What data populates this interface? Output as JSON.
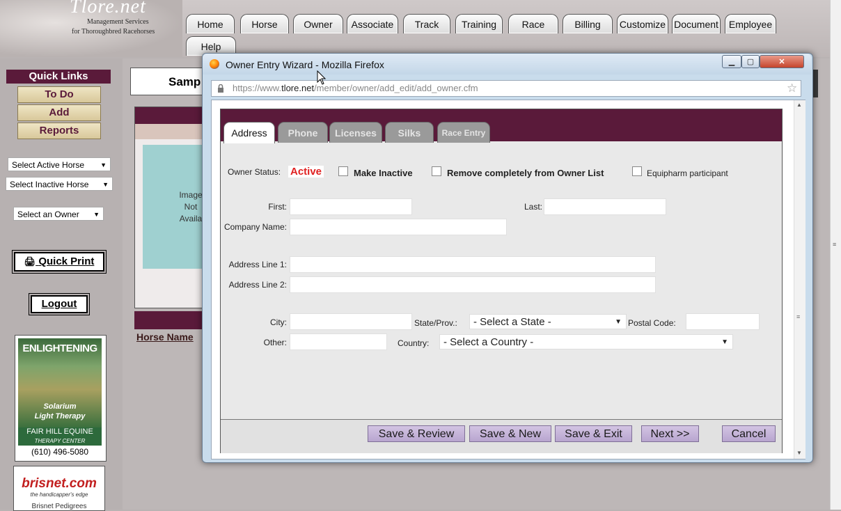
{
  "site": {
    "logo": "Tlore.net",
    "subtitle_line1": "Management Services",
    "subtitle_line2": "for Thoroughbred Racehorses",
    "nav": [
      "Home",
      "Horse",
      "Owner",
      "Associate",
      "Track",
      "Training",
      "Race",
      "Billing",
      "Customize",
      "Document",
      "Employee",
      "Help"
    ]
  },
  "sidebar": {
    "quick_links_title": "Quick Links",
    "links": [
      "To Do",
      "Add",
      "Reports"
    ],
    "select_active_horse": "Select Active Horse",
    "select_inactive_horse": "Select Inactive Horse",
    "select_owner": "Select an Owner",
    "quick_print": "Quick Print",
    "logout": "Logout"
  },
  "ads": {
    "ad1_title": "ENLIGHTENING",
    "ad1_sub1": "Solarium",
    "ad1_sub2": "Light Therapy",
    "ad1_fh1": "FAIR HILL EQUINE",
    "ad1_fh2": "THERAPY CENTER",
    "ad1_phone": "(610) 496-5080",
    "ad2_title": "brisnet.com",
    "ad2_tagline": "the handicapper's edge",
    "ad2_bottom": "Brisnet Pedigrees"
  },
  "main": {
    "samp_label": "Samp",
    "no_image": [
      "Image",
      "Not",
      "Availa"
    ],
    "horse_name_header": "Horse Name"
  },
  "popup": {
    "title": "Owner Entry Wizard - Mozilla Firefox",
    "url_prefix": "https://www.",
    "url_domain": "tlore.net",
    "url_path": "/member/owner/add_edit/add_owner.cfm",
    "tabs": [
      "Address",
      "Phone",
      "Licenses",
      "Silks",
      "Race Entry"
    ],
    "active_tab": "Address",
    "owner_status_label": "Owner Status:",
    "owner_status_value": "Active",
    "make_inactive": "Make Inactive",
    "remove_completely": "Remove completely from Owner List",
    "equipharm": "Equipharm participant",
    "fields": {
      "first": "First:",
      "last": "Last:",
      "company": "Company Name:",
      "address1": "Address Line 1:",
      "address2": "Address Line 2:",
      "city": "City:",
      "state_label": "State/Prov.:",
      "state_value": "- Select a State -",
      "postal": "Postal Code:",
      "other": "Other:",
      "country_label": "Country:",
      "country_value": "- Select a Country -"
    },
    "buttons": [
      "Save & Review",
      "Save & New",
      "Save & Exit",
      "Next >>",
      "Cancel"
    ]
  },
  "colors": {
    "maroon": "#5a1a3a",
    "active_red": "#e02020",
    "button_lavender": "#c6b5da"
  }
}
